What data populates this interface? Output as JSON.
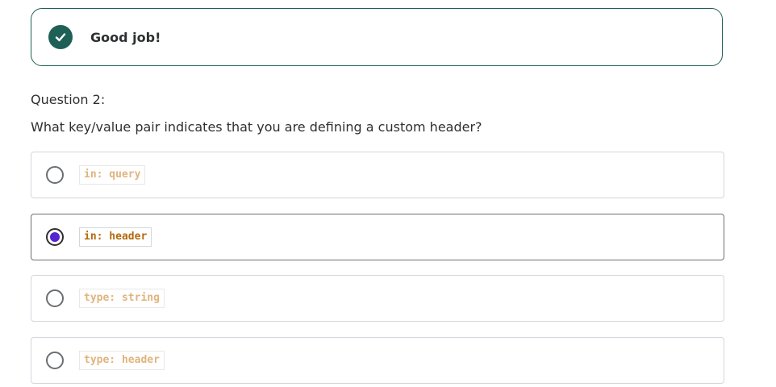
{
  "feedback": {
    "message": "Good job!",
    "icon": "check-circle-icon",
    "color": "#1e6055"
  },
  "question": {
    "number_label": "Question 2:",
    "text": "What key/value pair indicates that you are defining a custom header?"
  },
  "options": [
    {
      "label": "in: query",
      "selected": false
    },
    {
      "label": "in: header",
      "selected": true
    },
    {
      "label": "type: string",
      "selected": false
    },
    {
      "label": "type: header",
      "selected": false
    }
  ],
  "colors": {
    "selected_dot": "#5624d0",
    "code_text": "#b4690e",
    "code_text_faded": "#e0b47e",
    "border": "#d1d7dc"
  }
}
